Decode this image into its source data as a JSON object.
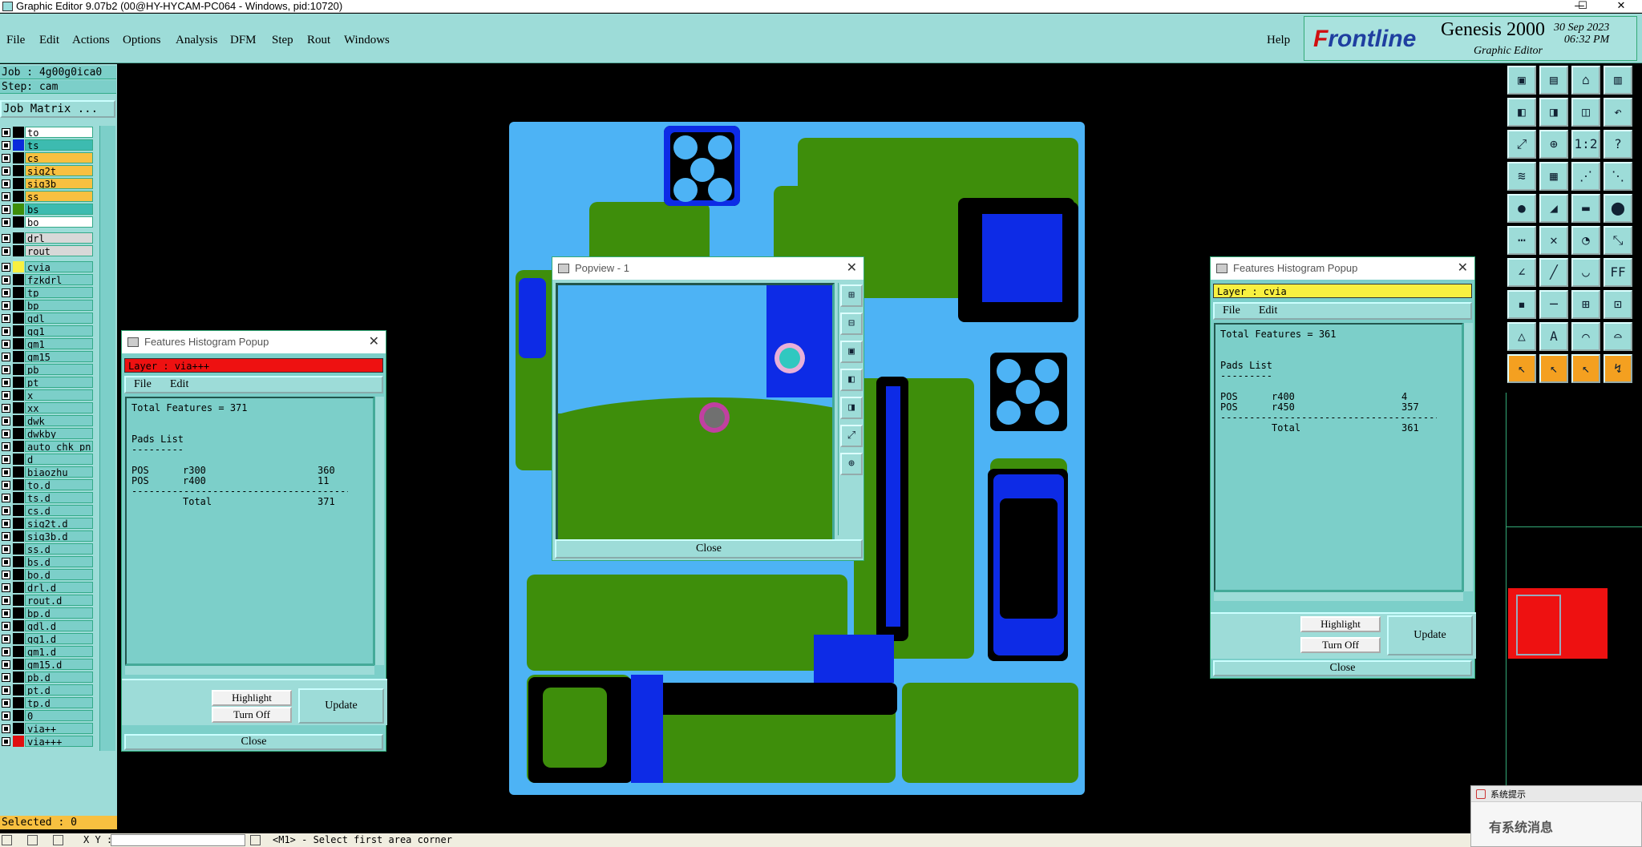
{
  "window": {
    "title": "Graphic Editor 9.07b2 (00@HY-HYCAM-PC064 - Windows, pid:10720)",
    "minimize": "—",
    "maximize": "☐",
    "close": "✕"
  },
  "menu": {
    "items": [
      "File",
      "Edit",
      "Actions",
      "Options",
      "Analysis",
      "DFM",
      "Step",
      "Rout",
      "Windows"
    ],
    "help": "Help"
  },
  "brand": {
    "logo_prefix": "F",
    "logo_rest": "rontline",
    "product": "Genesis 2000",
    "subtitle": "Graphic Editor",
    "date": "30 Sep 2023",
    "time": "06:32 PM"
  },
  "left_panel": {
    "job": "Job : 4g00g0ica0",
    "step": "Step: cam",
    "job_matrix": "Job Matrix ...",
    "layers": [
      {
        "name": "to",
        "swatch": "#000000",
        "bg": "#ffffff"
      },
      {
        "name": "ts",
        "swatch": "#0a2bdc",
        "bg": "#3dbbb0"
      },
      {
        "name": "cs",
        "swatch": "#000000",
        "bg": "#f8c040"
      },
      {
        "name": "sig2t",
        "swatch": "#000000",
        "bg": "#f8c040"
      },
      {
        "name": "sig3b",
        "swatch": "#000000",
        "bg": "#f8c040"
      },
      {
        "name": "ss",
        "swatch": "#000000",
        "bg": "#f8c040"
      },
      {
        "name": "bs",
        "swatch": "#3e8e0b",
        "bg": "#3dbbb0"
      },
      {
        "name": "bo",
        "swatch": "#000000",
        "bg": "#ffffff"
      },
      {
        "name": "drl",
        "swatch": "#000000",
        "bg": "#d8d8d8"
      },
      {
        "name": "rout",
        "swatch": "#000000",
        "bg": "#d8d8d8"
      },
      {
        "name": "cvia",
        "swatch": "#f8f040",
        "bg": "#7ccfc9"
      },
      {
        "name": "fzkdrl",
        "swatch": "#000000",
        "bg": "#7ccfc9"
      },
      {
        "name": "tp",
        "swatch": "#000000",
        "bg": "#7ccfc9"
      },
      {
        "name": "bp",
        "swatch": "#000000",
        "bg": "#7ccfc9"
      },
      {
        "name": "gdl",
        "swatch": "#000000",
        "bg": "#7ccfc9"
      },
      {
        "name": "gg1",
        "swatch": "#000000",
        "bg": "#7ccfc9"
      },
      {
        "name": "gm1",
        "swatch": "#000000",
        "bg": "#7ccfc9"
      },
      {
        "name": "gm15",
        "swatch": "#000000",
        "bg": "#7ccfc9"
      },
      {
        "name": "pb",
        "swatch": "#000000",
        "bg": "#7ccfc9"
      },
      {
        "name": "pt",
        "swatch": "#000000",
        "bg": "#7ccfc9"
      },
      {
        "name": "x",
        "swatch": "#000000",
        "bg": "#7ccfc9"
      },
      {
        "name": "xx",
        "swatch": "#000000",
        "bg": "#7ccfc9"
      },
      {
        "name": "dwk",
        "swatch": "#000000",
        "bg": "#7ccfc9"
      },
      {
        "name": "dwkby",
        "swatch": "#000000",
        "bg": "#7ccfc9"
      },
      {
        "name": "auto_chk_pn",
        "swatch": "#000000",
        "bg": "#7ccfc9"
      },
      {
        "name": "d",
        "swatch": "#000000",
        "bg": "#7ccfc9"
      },
      {
        "name": "biaozhu",
        "swatch": "#000000",
        "bg": "#7ccfc9"
      },
      {
        "name": "to.d",
        "swatch": "#000000",
        "bg": "#7ccfc9"
      },
      {
        "name": "ts.d",
        "swatch": "#000000",
        "bg": "#7ccfc9"
      },
      {
        "name": "cs.d",
        "swatch": "#000000",
        "bg": "#7ccfc9"
      },
      {
        "name": "sig2t.d",
        "swatch": "#000000",
        "bg": "#7ccfc9"
      },
      {
        "name": "sig3b.d",
        "swatch": "#000000",
        "bg": "#7ccfc9"
      },
      {
        "name": "ss.d",
        "swatch": "#000000",
        "bg": "#7ccfc9"
      },
      {
        "name": "bs.d",
        "swatch": "#000000",
        "bg": "#7ccfc9"
      },
      {
        "name": "bo.d",
        "swatch": "#000000",
        "bg": "#7ccfc9"
      },
      {
        "name": "drl.d",
        "swatch": "#000000",
        "bg": "#7ccfc9"
      },
      {
        "name": "rout.d",
        "swatch": "#000000",
        "bg": "#7ccfc9"
      },
      {
        "name": "bp.d",
        "swatch": "#000000",
        "bg": "#7ccfc9"
      },
      {
        "name": "gdl.d",
        "swatch": "#000000",
        "bg": "#7ccfc9"
      },
      {
        "name": "gg1.d",
        "swatch": "#000000",
        "bg": "#7ccfc9"
      },
      {
        "name": "gm1.d",
        "swatch": "#000000",
        "bg": "#7ccfc9"
      },
      {
        "name": "gm15.d",
        "swatch": "#000000",
        "bg": "#7ccfc9"
      },
      {
        "name": "pb.d",
        "swatch": "#000000",
        "bg": "#7ccfc9"
      },
      {
        "name": "pt.d",
        "swatch": "#000000",
        "bg": "#7ccfc9"
      },
      {
        "name": "tp.d",
        "swatch": "#000000",
        "bg": "#7ccfc9"
      },
      {
        "name": "0",
        "swatch": "#000000",
        "bg": "#7ccfc9"
      },
      {
        "name": "via++",
        "swatch": "#000000",
        "bg": "#7ccfc9"
      },
      {
        "name": "via+++",
        "swatch": "#e01010",
        "bg": "#7ccfc9"
      }
    ],
    "selected": "Selected : 0"
  },
  "status_bar": {
    "coords_label": "X Y :",
    "prompt": "<M1> - Select first area corner"
  },
  "popview": {
    "title": "Popview - 1",
    "close": "Close"
  },
  "hist_left": {
    "title": "Features Histogram Popup",
    "layer": "Layer :  via+++",
    "layer_color": "#ee1111",
    "menu": [
      "File",
      "Edit"
    ],
    "total_line": "Total Features = 371",
    "list_title": "Pads List",
    "underline": "---------",
    "rows": [
      {
        "type": "POS",
        "sym": "r300",
        "count": "360"
      },
      {
        "type": "POS",
        "sym": "r400",
        "count": "11"
      }
    ],
    "separator": "--------------------------------------------",
    "total_label": "Total",
    "total_value": "371",
    "highlight": "Highlight",
    "turn_off": "Turn Off",
    "update": "Update",
    "close": "Close"
  },
  "hist_right": {
    "title": "Features Histogram Popup",
    "layer": "Layer :  cvia",
    "layer_color": "#f8f040",
    "menu": [
      "File",
      "Edit"
    ],
    "total_line": "Total Features = 361",
    "list_title": "Pads List",
    "underline": "---------",
    "rows": [
      {
        "type": "POS",
        "sym": "r400",
        "count": "4"
      },
      {
        "type": "POS",
        "sym": "r450",
        "count": "357"
      }
    ],
    "separator": "--------------------------------------------",
    "total_label": "Total",
    "total_value": "361",
    "highlight": "Highlight",
    "turn_off": "Turn Off",
    "update": "Update",
    "close": "Close"
  },
  "notice": {
    "title": "系统提示",
    "text": "有系统消息"
  },
  "right_tools": {
    "icons": [
      "zoom-home-icon",
      "zoom-in-icon",
      "home-icon",
      "window-icon",
      "pan-left-icon",
      "pan-right-icon",
      "snap-icon",
      "redo-icon",
      "fit-icon",
      "center-icon",
      "ratio-icon",
      "help-icon",
      "measure-icon",
      "grid-icon",
      "connect-icon",
      "compare-icon",
      "point-icon",
      "line-icon",
      "rect-icon",
      "circle-icon",
      "node-icon",
      "cross-icon",
      "arc-icon",
      "link-icon",
      "angle-icon",
      "slash-icon",
      "curve-icon",
      "ff-icon",
      "pad-icon",
      "minus-icon",
      "net-icon",
      "group-icon",
      "tri-icon",
      "a-icon",
      "arch-icon",
      "arch-fill-icon",
      "pointer-icon",
      "pointer2-icon",
      "pointer3-icon",
      "pointer4-icon"
    ],
    "labels": [
      "▣",
      "▤",
      "⌂",
      "▥",
      "◧",
      "◨",
      "◫",
      "↶",
      "⤢",
      "⊕",
      "1:2",
      "?",
      "≋",
      "▦",
      "⋰",
      "⋱",
      "●",
      "◢",
      "▬",
      "⬤",
      "⋯",
      "✕",
      "◔",
      "⤡",
      "∠",
      "╱",
      "◡",
      "FF",
      "▪",
      "─",
      "⊞",
      "⊡",
      "△",
      "A",
      "⌒",
      "⌓",
      "↖",
      "↖",
      "↖",
      "↯"
    ]
  }
}
